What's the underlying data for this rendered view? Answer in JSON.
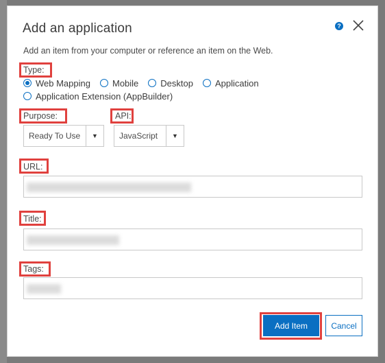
{
  "dialog": {
    "title": "Add an application",
    "subtitle": "Add an item from your computer or reference an item on the Web."
  },
  "type": {
    "label": "Type:",
    "options": [
      {
        "label": "Web Mapping",
        "checked": true
      },
      {
        "label": "Mobile",
        "checked": false
      },
      {
        "label": "Desktop",
        "checked": false
      },
      {
        "label": "Application",
        "checked": false
      },
      {
        "label": "Application Extension (AppBuilder)",
        "checked": false
      }
    ]
  },
  "purpose": {
    "label": "Purpose:",
    "value": "Ready To Use"
  },
  "api": {
    "label": "API:",
    "value": "JavaScript"
  },
  "url": {
    "label": "URL:",
    "value": ""
  },
  "title_field": {
    "label": "Title:",
    "value": ""
  },
  "tags": {
    "label": "Tags:",
    "value": ""
  },
  "buttons": {
    "add_item": "Add Item",
    "cancel": "Cancel"
  },
  "colors": {
    "accent": "#0a6fc2",
    "highlight": "#e0413e"
  },
  "icons": {
    "help": "help-icon",
    "close": "close-icon",
    "dropdown": "chevron-down-icon"
  }
}
